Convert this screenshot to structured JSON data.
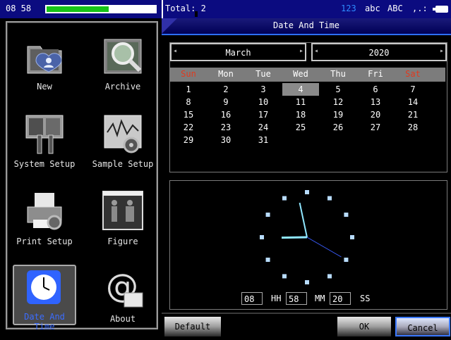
{
  "status": {
    "time": "08 58",
    "battery_level": 0.6,
    "total": "Total: 2",
    "input_modes": [
      "123",
      "abc",
      "ABC",
      ",.:"
    ],
    "active_mode_color": "#2e8bff"
  },
  "sidebar": {
    "items": [
      {
        "label": "New",
        "icon": "new-folder-icon"
      },
      {
        "label": "Archive",
        "icon": "archive-search-icon"
      },
      {
        "label": "System Setup",
        "icon": "system-setup-tools-icon"
      },
      {
        "label": "Sample Setup",
        "icon": "sample-setup-icon"
      },
      {
        "label": "Print Setup",
        "icon": "printer-icon"
      },
      {
        "label": "Figure",
        "icon": "figure-body-icon"
      },
      {
        "label": "Date And Time",
        "icon": "clock-icon",
        "selected": true
      },
      {
        "label": "About",
        "icon": "about-at-icon"
      }
    ]
  },
  "dialog": {
    "title": "Date And Time",
    "month": "March",
    "year": "2020",
    "weekdays": [
      "Sun",
      "Mon",
      "Tue",
      "Wed",
      "Thu",
      "Fri",
      "Sat"
    ],
    "weekend_color": "#e03a1e",
    "days": [
      [
        "1",
        "2",
        "3",
        "4",
        "5",
        "6",
        "7"
      ],
      [
        "8",
        "9",
        "10",
        "11",
        "12",
        "13",
        "14"
      ],
      [
        "15",
        "16",
        "17",
        "18",
        "19",
        "20",
        "21"
      ],
      [
        "22",
        "23",
        "24",
        "25",
        "26",
        "27",
        "28"
      ],
      [
        "29",
        "30",
        "31",
        "",
        "",
        "",
        ""
      ]
    ],
    "selected_day": "4",
    "time": {
      "hh": "08",
      "hh_label": "HH",
      "mm": "58",
      "mm_label": "MM",
      "ss": "20",
      "ss_label": "SS"
    },
    "buttons": {
      "default": "Default",
      "ok": "OK",
      "cancel": "Cancel"
    }
  }
}
